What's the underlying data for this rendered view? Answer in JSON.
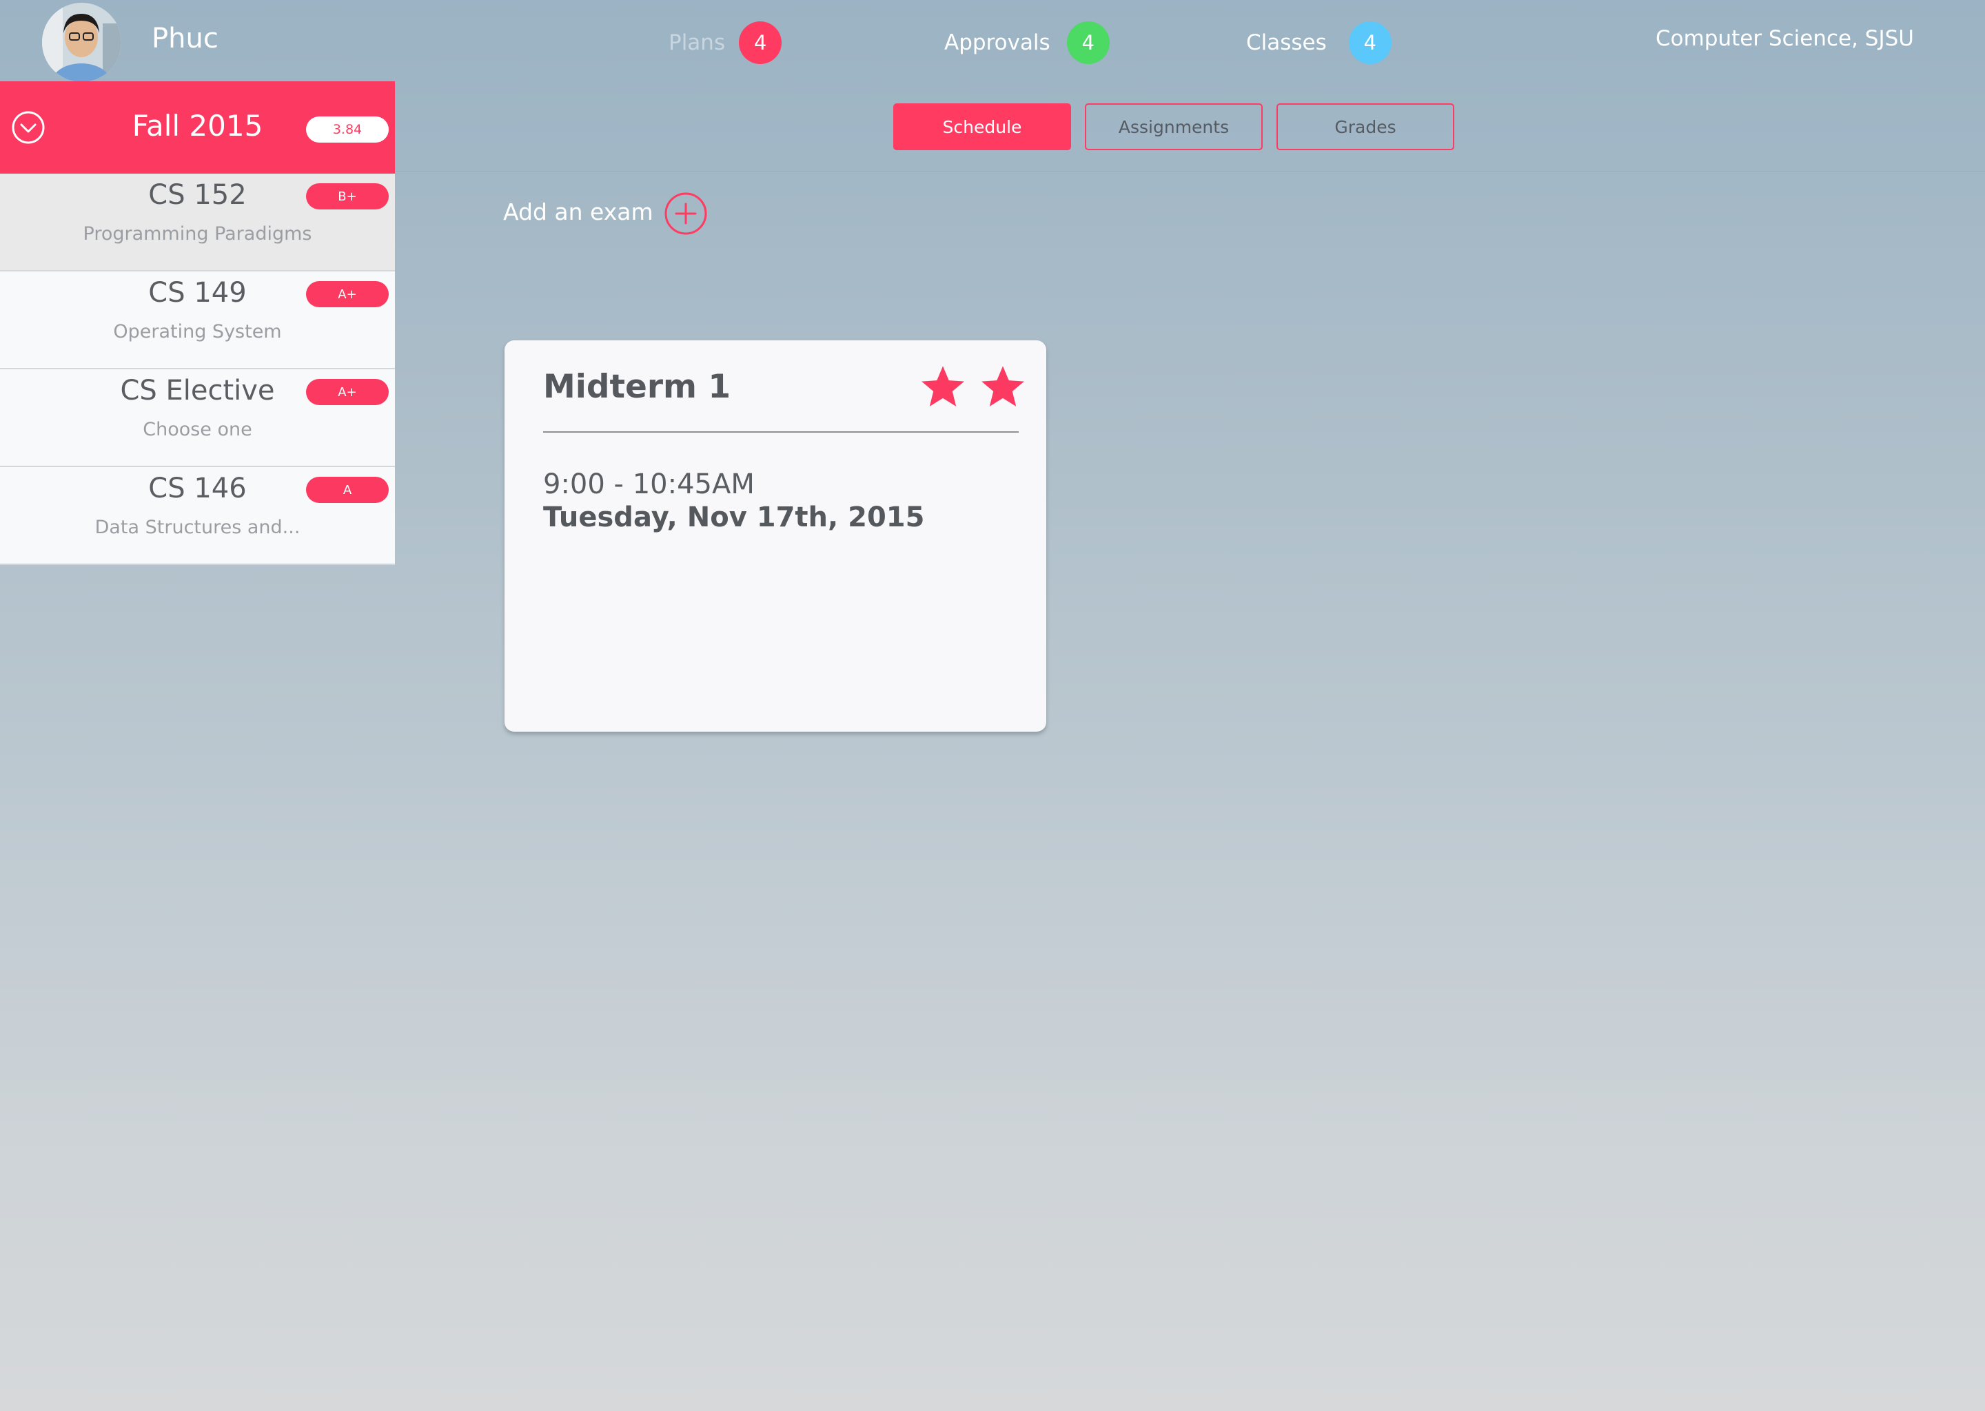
{
  "user": {
    "name": "Phuc"
  },
  "nav": {
    "plans": {
      "label": "Plans",
      "count": "4",
      "color": "#ff3b62"
    },
    "approvals": {
      "label": "Approvals",
      "count": "4",
      "color": "#4cd964"
    },
    "classes": {
      "label": "Classes",
      "count": "4",
      "color": "#5ac8fa"
    }
  },
  "institution": "Computer Science, SJSU",
  "tabs": [
    {
      "label": "Schedule",
      "active": true
    },
    {
      "label": "Assignments",
      "active": false
    },
    {
      "label": "Grades",
      "active": false
    }
  ],
  "semester": {
    "title": "Fall 2015",
    "gpa": "3.84"
  },
  "courses": [
    {
      "code": "CS 152",
      "name": "Programming Paradigms",
      "grade": "B+",
      "selected": true
    },
    {
      "code": "CS 149",
      "name": "Operating System",
      "grade": "A+",
      "selected": false
    },
    {
      "code": "CS Elective",
      "name": "Choose one",
      "grade": "A+",
      "selected": false
    },
    {
      "code": "CS 146",
      "name": "Data Structures and...",
      "grade": "A",
      "selected": false
    }
  ],
  "add_exam": {
    "label": "Add an exam"
  },
  "exam": {
    "title": "Midterm 1",
    "time": "9:00 - 10:45AM",
    "date": "Tuesday, Nov 17th, 2015",
    "stars": 2
  },
  "colors": {
    "accent": "#ff3b62",
    "text_dark": "#55595e",
    "text_muted": "#9a9ea3"
  },
  "icons": {
    "avatar": "user-photo",
    "collapse": "chevron-down-circle-icon",
    "add": "plus-circle-icon",
    "star": "star-icon"
  }
}
